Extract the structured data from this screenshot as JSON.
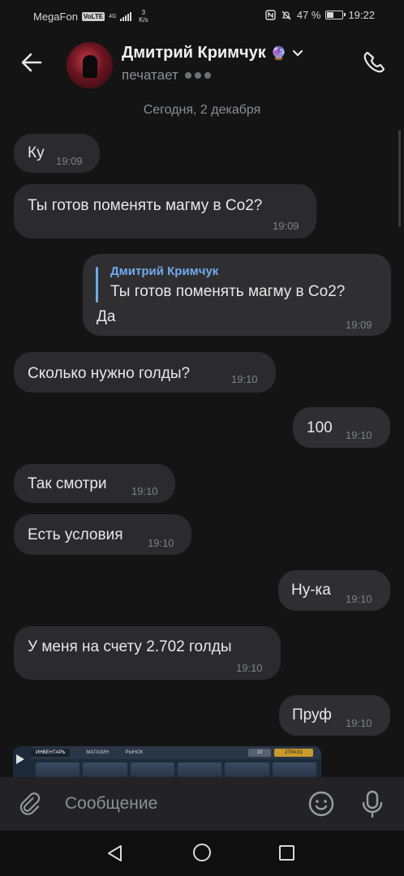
{
  "status_bar": {
    "carrier": "MegaFon",
    "volte": "VoLTE",
    "network": "4G",
    "speed_value": "3",
    "speed_unit": "K/s",
    "battery": "47 %",
    "battery_level": 0.47,
    "time": "19:22"
  },
  "header": {
    "contact_name": "Дмитрий Кримчук",
    "name_emoji": "🔮",
    "status": "печатает",
    "back_icon": "arrow-left-icon",
    "call_icon": "phone-icon"
  },
  "date_separator": "Сегодня, 2 декабря",
  "messages": [
    {
      "direction": "in",
      "text": "Ку",
      "time": "19:09"
    },
    {
      "direction": "in",
      "text": "Ты готов поменять магму в Co2?",
      "time": "19:09"
    },
    {
      "direction": "out",
      "reply_name": "Дмитрий Кримчук",
      "reply_text": "Ты готов поменять магму в Co2?",
      "text": "Да",
      "time": "19:09"
    },
    {
      "direction": "in",
      "text": "Сколько нужно голды?",
      "time": "19:10"
    },
    {
      "direction": "out",
      "text": "100",
      "time": "19:10"
    },
    {
      "direction": "in",
      "text": "Так смотри",
      "time": "19:10"
    },
    {
      "direction": "in",
      "text": "Есть условия",
      "time": "19:10"
    },
    {
      "direction": "out",
      "text": "Ну-ка",
      "time": "19:10"
    },
    {
      "direction": "in",
      "text": "У меня на счету 2.702 голды",
      "time": "19:10"
    },
    {
      "direction": "out",
      "text": "Пруф",
      "time": "19:10"
    }
  ],
  "media_preview": {
    "tab_inventory": "ИНВЕНТАРЬ",
    "tab_shop": "МАГАЗИН",
    "tab_market": "РЫНОК",
    "silver": "10",
    "gold": "2704.01"
  },
  "composer": {
    "placeholder": "Сообщение"
  }
}
